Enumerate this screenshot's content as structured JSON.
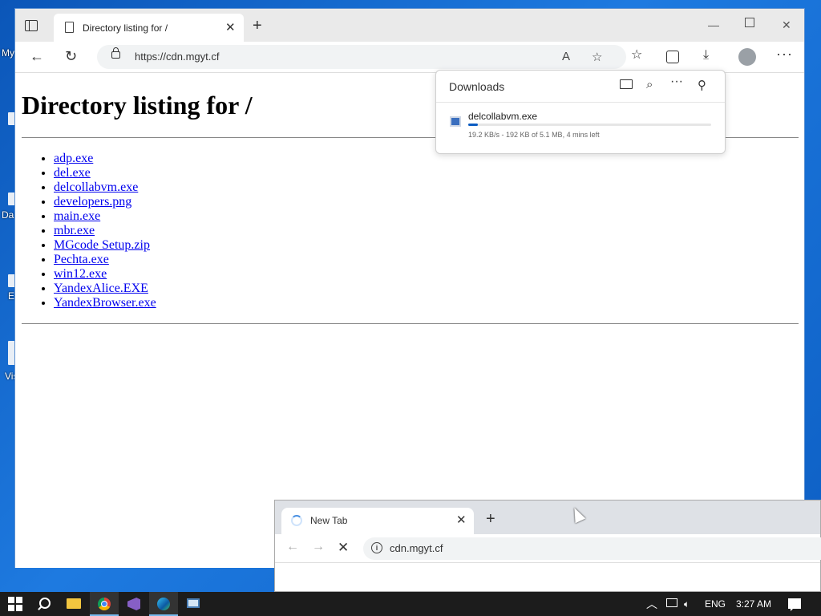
{
  "desktop": {
    "labels": [
      "My",
      "Da",
      "E",
      "Vis"
    ]
  },
  "edge": {
    "tab": {
      "title": "Directory listing for /"
    },
    "address": "https://cdn.mgyt.cf",
    "downloads": {
      "title": "Downloads",
      "item": {
        "name": "delcollabvm.exe",
        "status": "19.2 KB/s - 192 KB of 5.1 MB, 4 mins left",
        "progress": 0.04
      }
    },
    "page": {
      "heading": "Directory listing for /",
      "files": [
        "adp.exe",
        "del.exe",
        "delcollabvm.exe",
        "developers.png",
        "main.exe",
        "mbr.exe",
        "MGcode Setup.zip",
        "Pechta.exe",
        "win12.exe",
        "YandexAlice.EXE",
        "YandexBrowser.exe"
      ]
    }
  },
  "chrome": {
    "tab": {
      "title": "New Tab"
    },
    "address": "cdn.mgyt.cf"
  },
  "taskbar": {
    "language": "ENG",
    "time": "3:27 AM"
  },
  "icons": {
    "tab_actions": "tab-actions-icon",
    "back": "arrow-left-icon",
    "refresh": "refresh-icon",
    "read_aloud": "read-aloud-icon",
    "add_favorite": "star-plus-icon",
    "favorites": "favorites-icon",
    "collections": "collections-icon",
    "downloads": "download-icon",
    "more": "more-icon"
  }
}
